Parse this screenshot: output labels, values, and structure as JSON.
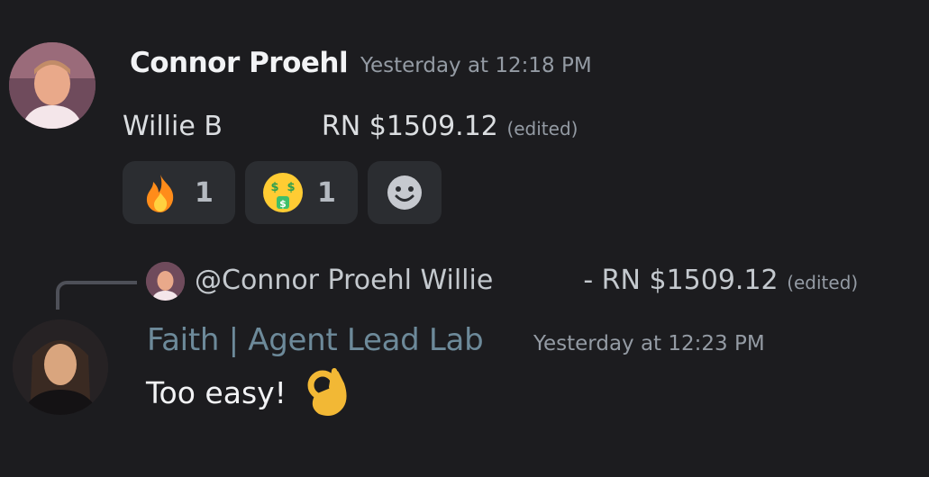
{
  "message1": {
    "author": "Connor Proehl",
    "timestamp": "Yesterday at 12:18 PM",
    "text_start": "Willie B",
    "text_end": "RN $1509.12",
    "edited_label": "(edited)",
    "reactions": [
      {
        "emoji": "fire-emoji",
        "count": "1"
      },
      {
        "emoji": "money-mouth-face-emoji",
        "count": "1"
      },
      {
        "emoji": "add-reaction-smiley-icon"
      }
    ]
  },
  "reply": {
    "mention": "@Connor Proehl",
    "snippet_start": "Willie",
    "snippet_end": "- RN $1509.12",
    "edited_label": "(edited)"
  },
  "message2": {
    "author": "Faith | Agent Lead Lab",
    "author_color": "#6d8a9a",
    "timestamp": "Yesterday at 12:23 PM",
    "text": "Too easy!",
    "emoji": "ok-hand-emoji"
  }
}
